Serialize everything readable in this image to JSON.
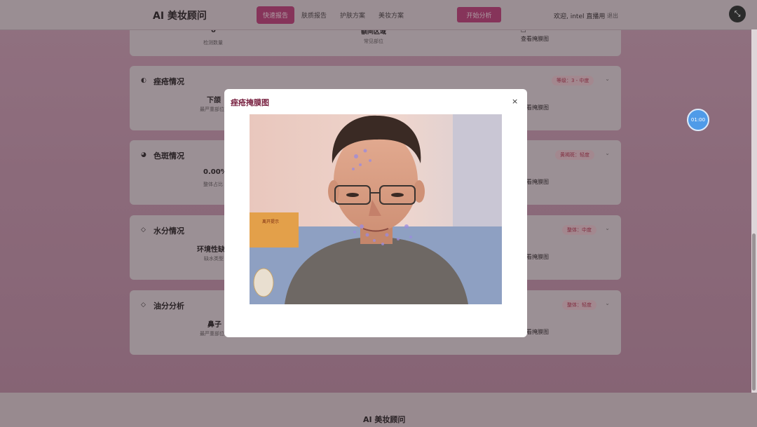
{
  "header": {
    "brand": "AI 美妆顾问",
    "nav": [
      "快速报告",
      "肤质报告",
      "护肤方案",
      "美妆方案"
    ],
    "start_label": "开始分析",
    "welcome": "欢迎, intel 直播用",
    "logout": "退出"
  },
  "top_card": {
    "stat_value": "0",
    "stat_label": "检测数量",
    "mid_value": "额间区域",
    "mid_label": "常见部位",
    "mask_icon": "□",
    "mask_link": "查看掩膜图"
  },
  "cards": [
    {
      "title": "痤疮情况",
      "badge": "等级：3 - 中度",
      "value": "下颌",
      "label": "最严重部位",
      "mask_link": "看掩膜图"
    },
    {
      "title": "色斑情况",
      "badge": "黄褐斑：轻度",
      "value": "0.00%",
      "label": "整体占比",
      "mask_link": "看掩膜图"
    },
    {
      "title": "水分情况",
      "badge": "整体：中度",
      "value": "环境性缺",
      "label": "缺水类型",
      "mask_link": "看掩膜图"
    },
    {
      "title": "油分分析",
      "badge": "整体：轻度",
      "value": "鼻子",
      "label": "最严重部位",
      "mask_link": "看掩膜图"
    }
  ],
  "timer": "01:00",
  "modal": {
    "title": "痤疮掩膜图",
    "close": "×",
    "sign_text": "离开提示"
  },
  "footer": {
    "brand": "AI 美妆顾问"
  },
  "colors": {
    "accent": "#b9457b",
    "badge_text": "#b03a52",
    "timer": "#4f9be8"
  }
}
